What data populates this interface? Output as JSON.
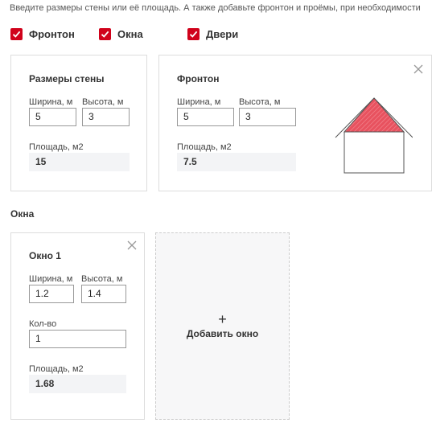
{
  "intro": "Введите размеры стены или её площадь. А также добавьте фронтон и проёмы, при необходимости",
  "options": [
    {
      "label": "Фронтон",
      "checked": true
    },
    {
      "label": "Окна",
      "checked": true
    },
    {
      "label": "Двери",
      "checked": true
    }
  ],
  "wall": {
    "title": "Размеры стены",
    "width_label": "Ширина, м",
    "width_value": "5",
    "height_label": "Высота, м",
    "height_value": "3",
    "area_label": "Площадь, м2",
    "area_value": "15"
  },
  "gable": {
    "title": "Фронтон",
    "width_label": "Ширина, м",
    "width_value": "5",
    "height_label": "Высота, м",
    "height_value": "3",
    "area_label": "Площадь, м2",
    "area_value": "7.5"
  },
  "windows": {
    "section_title": "Окна",
    "items": [
      {
        "title": "Окно 1",
        "width_label": "Ширина, м",
        "width_value": "1.2",
        "height_label": "Высота, м",
        "height_value": "1.4",
        "count_label": "Кол-во",
        "count_value": "1",
        "area_label": "Площадь, м2",
        "area_value": "1.68"
      }
    ],
    "add_plus": "+",
    "add_label": "Добавить окно"
  },
  "colors": {
    "accent": "#d0021b",
    "gable_fill": "#e8525f",
    "border": "#dddddd",
    "readonly_bg": "#f3f4f6"
  }
}
